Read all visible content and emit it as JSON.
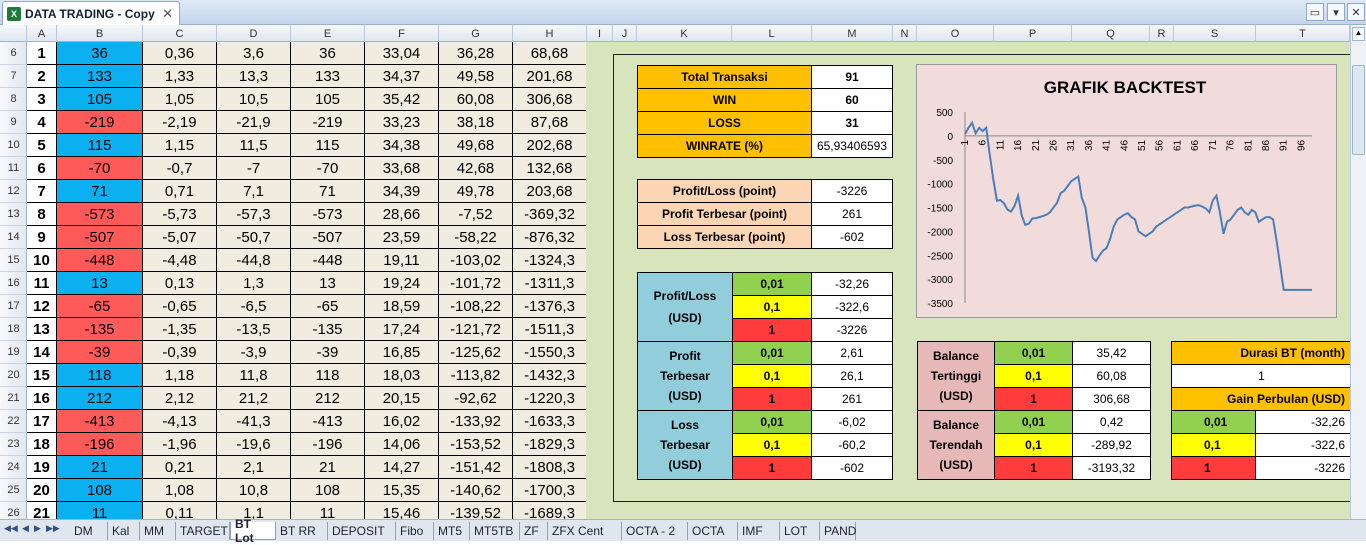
{
  "window": {
    "title": "DATA TRADING - Copy",
    "icon": "excel-icon",
    "close": "✕"
  },
  "columns_left": [
    "A",
    "B",
    "C",
    "D",
    "E",
    "F",
    "G",
    "H",
    "I",
    "J"
  ],
  "columns_right": [
    "K",
    "L",
    "M",
    "N",
    "O",
    "P",
    "Q",
    "R",
    "S",
    "T"
  ],
  "rows": [
    {
      "r": "6",
      "n": "1",
      "b": "36",
      "c": "0,36",
      "d": "3,6",
      "e": "36",
      "f": "33,04",
      "g": "36,28",
      "h": "68,68",
      "color": "blue"
    },
    {
      "r": "7",
      "n": "2",
      "b": "133",
      "c": "1,33",
      "d": "13,3",
      "e": "133",
      "f": "34,37",
      "g": "49,58",
      "h": "201,68",
      "color": "blue"
    },
    {
      "r": "8",
      "n": "3",
      "b": "105",
      "c": "1,05",
      "d": "10,5",
      "e": "105",
      "f": "35,42",
      "g": "60,08",
      "h": "306,68",
      "color": "blue"
    },
    {
      "r": "9",
      "n": "4",
      "b": "-219",
      "c": "-2,19",
      "d": "-21,9",
      "e": "-219",
      "f": "33,23",
      "g": "38,18",
      "h": "87,68",
      "color": "red"
    },
    {
      "r": "10",
      "n": "5",
      "b": "115",
      "c": "1,15",
      "d": "11,5",
      "e": "115",
      "f": "34,38",
      "g": "49,68",
      "h": "202,68",
      "color": "blue"
    },
    {
      "r": "11",
      "n": "6",
      "b": "-70",
      "c": "-0,7",
      "d": "-7",
      "e": "-70",
      "f": "33,68",
      "g": "42,68",
      "h": "132,68",
      "color": "red"
    },
    {
      "r": "12",
      "n": "7",
      "b": "71",
      "c": "0,71",
      "d": "7,1",
      "e": "71",
      "f": "34,39",
      "g": "49,78",
      "h": "203,68",
      "color": "blue"
    },
    {
      "r": "13",
      "n": "8",
      "b": "-573",
      "c": "-5,73",
      "d": "-57,3",
      "e": "-573",
      "f": "28,66",
      "g": "-7,52",
      "h": "-369,32",
      "color": "red"
    },
    {
      "r": "14",
      "n": "9",
      "b": "-507",
      "c": "-5,07",
      "d": "-50,7",
      "e": "-507",
      "f": "23,59",
      "g": "-58,22",
      "h": "-876,32",
      "color": "red"
    },
    {
      "r": "15",
      "n": "10",
      "b": "-448",
      "c": "-4,48",
      "d": "-44,8",
      "e": "-448",
      "f": "19,11",
      "g": "-103,02",
      "h": "-1324,3",
      "color": "red"
    },
    {
      "r": "16",
      "n": "11",
      "b": "13",
      "c": "0,13",
      "d": "1,3",
      "e": "13",
      "f": "19,24",
      "g": "-101,72",
      "h": "-1311,3",
      "color": "blue"
    },
    {
      "r": "17",
      "n": "12",
      "b": "-65",
      "c": "-0,65",
      "d": "-6,5",
      "e": "-65",
      "f": "18,59",
      "g": "-108,22",
      "h": "-1376,3",
      "color": "red"
    },
    {
      "r": "18",
      "n": "13",
      "b": "-135",
      "c": "-1,35",
      "d": "-13,5",
      "e": "-135",
      "f": "17,24",
      "g": "-121,72",
      "h": "-1511,3",
      "color": "red"
    },
    {
      "r": "19",
      "n": "14",
      "b": "-39",
      "c": "-0,39",
      "d": "-3,9",
      "e": "-39",
      "f": "16,85",
      "g": "-125,62",
      "h": "-1550,3",
      "color": "red"
    },
    {
      "r": "20",
      "n": "15",
      "b": "118",
      "c": "1,18",
      "d": "11,8",
      "e": "118",
      "f": "18,03",
      "g": "-113,82",
      "h": "-1432,3",
      "color": "blue"
    },
    {
      "r": "21",
      "n": "16",
      "b": "212",
      "c": "2,12",
      "d": "21,2",
      "e": "212",
      "f": "20,15",
      "g": "-92,62",
      "h": "-1220,3",
      "color": "blue"
    },
    {
      "r": "22",
      "n": "17",
      "b": "-413",
      "c": "-4,13",
      "d": "-41,3",
      "e": "-413",
      "f": "16,02",
      "g": "-133,92",
      "h": "-1633,3",
      "color": "red"
    },
    {
      "r": "23",
      "n": "18",
      "b": "-196",
      "c": "-1,96",
      "d": "-19,6",
      "e": "-196",
      "f": "14,06",
      "g": "-153,52",
      "h": "-1829,3",
      "color": "red"
    },
    {
      "r": "24",
      "n": "19",
      "b": "21",
      "c": "0,21",
      "d": "2,1",
      "e": "21",
      "f": "14,27",
      "g": "-151,42",
      "h": "-1808,3",
      "color": "blue"
    },
    {
      "r": "25",
      "n": "20",
      "b": "108",
      "c": "1,08",
      "d": "10,8",
      "e": "108",
      "f": "15,35",
      "g": "-140,62",
      "h": "-1700,3",
      "color": "blue"
    },
    {
      "r": "26",
      "n": "21",
      "b": "11",
      "c": "0,11",
      "d": "1,1",
      "e": "11",
      "f": "15,46",
      "g": "-139,52",
      "h": "-1689,3",
      "color": "blue"
    }
  ],
  "summary": {
    "total_label": "Total Transaksi",
    "total": "91",
    "win_label": "WIN",
    "win": "60",
    "loss_label": "LOSS",
    "loss": "31",
    "winrate_label": "WINRATE (%)",
    "winrate": "65,93406593",
    "pl_label": "Profit/Loss (point)",
    "pl": "-3226",
    "pmax_label": "Profit Terbesar (point)",
    "pmax": "261",
    "lmax_label": "Loss Terbesar (point)",
    "lmax": "-602"
  },
  "usd": {
    "pl_l1": "Profit/Loss",
    "pl_l2": "(USD)",
    "pt_l1": "Profit",
    "pt_l2": "Terbesar",
    "pt_l3": "(USD)",
    "lt_l1": "Loss",
    "lt_l2": "Terbesar",
    "lt_l3": "(USD)",
    "lots": [
      "0,01",
      "0,1",
      "1"
    ],
    "pl_vals": [
      "-32,26",
      "-322,6",
      "-3226"
    ],
    "pt_vals": [
      "2,61",
      "26,1",
      "261"
    ],
    "lt_vals": [
      "-6,02",
      "-60,2",
      "-602"
    ]
  },
  "balance": {
    "hi_l1": "Balance",
    "hi_l2": "Tertinggi",
    "hi_l3": "(USD)",
    "lo_l1": "Balance",
    "lo_l2": "Terendah",
    "lo_l3": "(USD)",
    "lots": [
      "0,01",
      "0,1",
      "1"
    ],
    "hi_vals": [
      "35,42",
      "60,08",
      "306,68"
    ],
    "lo_vals": [
      "0,42",
      "-289,92",
      "-3193,32"
    ]
  },
  "durasi": {
    "label": "Durasi BT (month)",
    "value": "1",
    "gain_label": "Gain Perbulan (USD)",
    "lots": [
      "0,01",
      "0,1",
      "1"
    ],
    "vals": [
      "-32,26",
      "-322,6",
      "-3226"
    ]
  },
  "chart_data": {
    "type": "line",
    "title": "GRAFIK BACKTEST",
    "ylim": [
      -3500,
      500
    ],
    "yticks": [
      "500",
      "0",
      "-500",
      "-1000",
      "-1500",
      "-2000",
      "-2500",
      "-3000",
      "-3500"
    ],
    "xticks": [
      "1",
      "6",
      "11",
      "16",
      "21",
      "26",
      "31",
      "36",
      "41",
      "46",
      "51",
      "56",
      "61",
      "66",
      "71",
      "76",
      "81",
      "86",
      "91",
      "96"
    ],
    "x": [
      1,
      2,
      3,
      4,
      5,
      6,
      7,
      8,
      9,
      10,
      11,
      12,
      13,
      14,
      15,
      16,
      17,
      18,
      19,
      20,
      21,
      22,
      23,
      24,
      25,
      26,
      27,
      28,
      29,
      30,
      31,
      32,
      33,
      34,
      35,
      36,
      37,
      38,
      39,
      40,
      41,
      42,
      43,
      44,
      45,
      46,
      47,
      48,
      49,
      50,
      51,
      52,
      53,
      54,
      55,
      56,
      57,
      58,
      59,
      60,
      61,
      62,
      63,
      64,
      65,
      66,
      67,
      68,
      69,
      70,
      71,
      72,
      73,
      74,
      75,
      76,
      77,
      78,
      79,
      80,
      81,
      82,
      83,
      84,
      85,
      86,
      87,
      88,
      89,
      90,
      91,
      92,
      93,
      94,
      95,
      96,
      97,
      98,
      99
    ],
    "y": [
      36,
      169,
      274,
      55,
      170,
      100,
      171,
      -402,
      -909,
      -1357,
      -1344,
      -1409,
      -1544,
      -1583,
      -1465,
      -1253,
      -1666,
      -1862,
      -1841,
      -1733,
      -1722,
      -1700,
      -1680,
      -1650,
      -1600,
      -1500,
      -1400,
      -1200,
      -1150,
      -1050,
      -950,
      -900,
      -850,
      -1300,
      -1500,
      -2000,
      -2550,
      -2620,
      -2500,
      -2400,
      -2350,
      -2150,
      -1900,
      -1750,
      -1700,
      -1650,
      -1620,
      -1700,
      -1750,
      -2000,
      -2050,
      -2100,
      -2050,
      -2000,
      -1900,
      -1850,
      -1800,
      -1750,
      -1700,
      -1650,
      -1600,
      -1550,
      -1500,
      -1500,
      -1480,
      -1460,
      -1450,
      -1480,
      -1520,
      -1600,
      -1350,
      -1250,
      -1600,
      -2050,
      -1800,
      -1750,
      -1650,
      -1550,
      -1500,
      -1600,
      -1650,
      -1550,
      -1600,
      -1800,
      -1750,
      -1700,
      -1700,
      -1750,
      -2200,
      -2700,
      -3226,
      -3226,
      -3226,
      -3226,
      -3226,
      -3226,
      -3226,
      -3226,
      -3226
    ],
    "grid": false
  },
  "sheets": [
    "DM",
    "Kal",
    "MM",
    "TARGET",
    "BT Lot",
    "BT RR",
    "DEPOSIT",
    "Fibo",
    "MT5",
    "MT5TB",
    "ZF",
    "ZFX Cent",
    "OCTA - 2",
    "OCTA",
    "IMF",
    "LOT",
    "PAND"
  ],
  "active_sheet": "BT Lot",
  "nav_icons": [
    "first-sheet-icon",
    "prev-sheet-icon",
    "next-sheet-icon",
    "last-sheet-icon"
  ],
  "colors": {
    "win": "#0ab0f0",
    "loss": "#ff5a5a",
    "panel": "#d8e4bc",
    "gold": "#ffc000",
    "chart_line": "#4a7ebb"
  }
}
